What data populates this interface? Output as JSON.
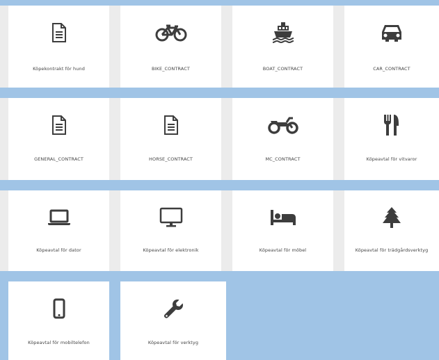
{
  "colors": {
    "background": "#a0c4e6",
    "tile": "#ffffff",
    "band": "#ececec",
    "icon": "#3d3d3d",
    "label": "#444444"
  },
  "contracts": [
    {
      "label": "Köpekontrakt för hund",
      "icon": "document-icon"
    },
    {
      "label": "BIKE_CONTRACT",
      "icon": "bicycle-icon"
    },
    {
      "label": "BOAT_CONTRACT",
      "icon": "ship-icon"
    },
    {
      "label": "CAR_CONTRACT",
      "icon": "car-icon"
    },
    {
      "label": "GENERAL_CONTRACT",
      "icon": "document-icon"
    },
    {
      "label": "HORSE_CONTRACT",
      "icon": "document-icon"
    },
    {
      "label": "MC_CONTRACT",
      "icon": "motorcycle-icon"
    },
    {
      "label": "Köpeavtal för vitvaror",
      "icon": "cutlery-icon"
    },
    {
      "label": "Köpeavtal för dator",
      "icon": "laptop-icon"
    },
    {
      "label": "Köpeavtal för elektronik",
      "icon": "monitor-icon"
    },
    {
      "label": "Köpeavtal för möbel",
      "icon": "bed-icon"
    },
    {
      "label": "Köpeavtal för trädgårdsverktyg",
      "icon": "tree-icon"
    },
    {
      "label": "Köpeavtal för mobiltelefon",
      "icon": "mobile-phone-icon"
    },
    {
      "label": "Köpeavtal för verktyg",
      "icon": "wrench-icon"
    }
  ]
}
